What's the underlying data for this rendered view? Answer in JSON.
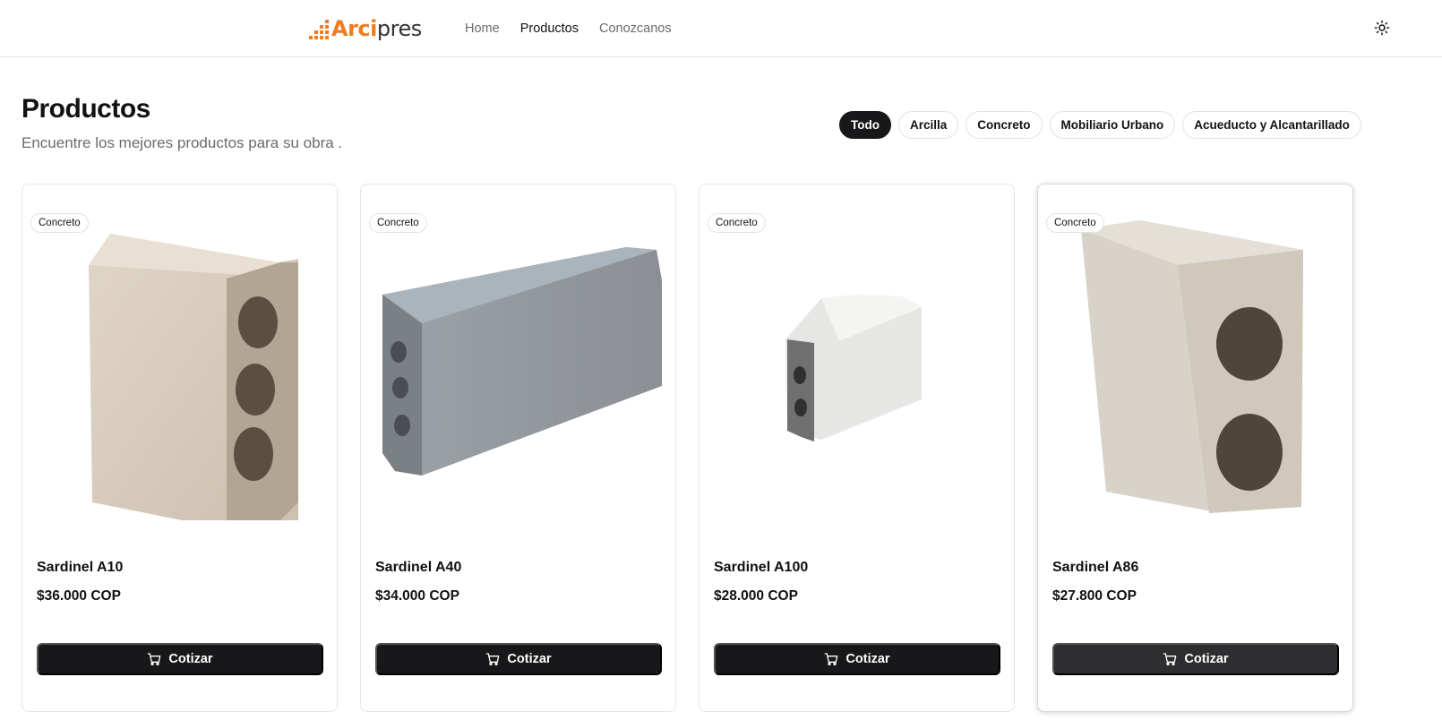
{
  "brand": {
    "part1": "Arci",
    "part2": "pres"
  },
  "nav": {
    "items": [
      {
        "label": "Home"
      },
      {
        "label": "Productos"
      },
      {
        "label": "Conozcanos"
      }
    ]
  },
  "page": {
    "title": "Productos",
    "subtitle": "Encuentre los mejores productos para su obra ."
  },
  "filters": [
    {
      "label": "Todo",
      "selected": true
    },
    {
      "label": "Arcilla",
      "selected": false
    },
    {
      "label": "Concreto",
      "selected": false
    },
    {
      "label": "Mobiliario Urbano",
      "selected": false
    },
    {
      "label": "Acueducto y Alcantarillado",
      "selected": false
    }
  ],
  "products": [
    {
      "category": "Concreto",
      "name": "Sardinel A10",
      "price": "$36.000 COP",
      "button": "Cotizar"
    },
    {
      "category": "Concreto",
      "name": "Sardinel A40",
      "price": "$34.000 COP",
      "button": "Cotizar"
    },
    {
      "category": "Concreto",
      "name": "Sardinel A100",
      "price": "$28.000 COP",
      "button": "Cotizar"
    },
    {
      "category": "Concreto",
      "name": "Sardinel A86",
      "price": "$27.800 COP",
      "button": "Cotizar"
    }
  ],
  "icons": {
    "theme": "sun-icon",
    "cart": "shopping-cart-icon"
  },
  "colors": {
    "brand_orange": "#f07c1e",
    "primary_dark": "#18181b"
  }
}
